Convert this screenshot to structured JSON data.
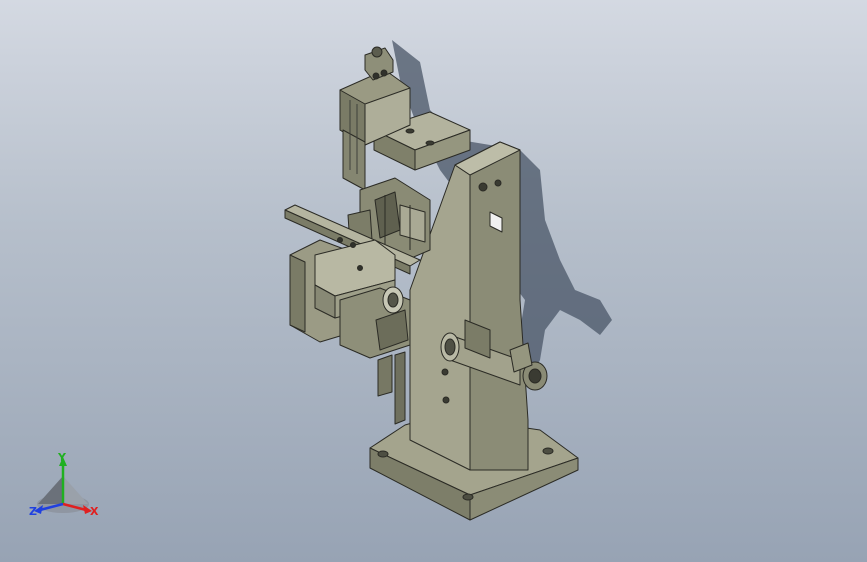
{
  "viewport": {
    "background_top": "#d4d9e2",
    "background_bottom": "#97a3b4",
    "model_color": "#9a9a83",
    "model_dark": "#6f705e",
    "model_light": "#c2c2ae",
    "edge_color": "#2b2b25",
    "shadow_color": "#4a5567"
  },
  "triad": {
    "x_label": "X",
    "y_label": "Y",
    "z_label": "Z",
    "x_color": "#e02020",
    "y_color": "#20b020",
    "z_color": "#2040e0"
  }
}
